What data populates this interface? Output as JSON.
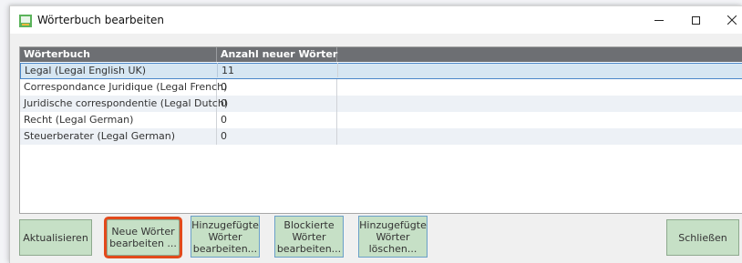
{
  "window": {
    "title": "Wörterbuch bearbeiten",
    "controls": {
      "minimize": "–",
      "maximize": "□",
      "close": "✕"
    }
  },
  "table": {
    "columns": [
      "Wörterbuch",
      "Anzahl neuer Wörter"
    ],
    "rows": [
      {
        "name": "Legal (Legal English UK)",
        "count": "11",
        "selected": true
      },
      {
        "name": "Correspondance Juridique (Legal French)",
        "count": "0"
      },
      {
        "name": "Juridische correspondentie (Legal Dutch)",
        "count": "0"
      },
      {
        "name": "Recht (Legal German)",
        "count": "0"
      },
      {
        "name": "Steuerberater (Legal German)",
        "count": "0"
      }
    ]
  },
  "buttons": {
    "refresh": "Aktualisieren",
    "edit_new_words": [
      "Neue Wörter",
      "bearbeiten ..."
    ],
    "edit_added_words": [
      "Hinzugefügte",
      "Wörter",
      "bearbeiten..."
    ],
    "edit_blocked_words": [
      "Blockierte",
      "Wörter",
      "bearbeiten..."
    ],
    "delete_added_words": [
      "Hinzugefügte",
      "Wörter",
      "löschen..."
    ],
    "close": "Schließen"
  },
  "colors": {
    "header_bg": "#6d6f73",
    "selection_border": "#4a87c9",
    "button_green": "#c6e0c6",
    "highlight_ring": "#e24a1c"
  },
  "icons": {
    "app": "dictionary-app-icon"
  }
}
